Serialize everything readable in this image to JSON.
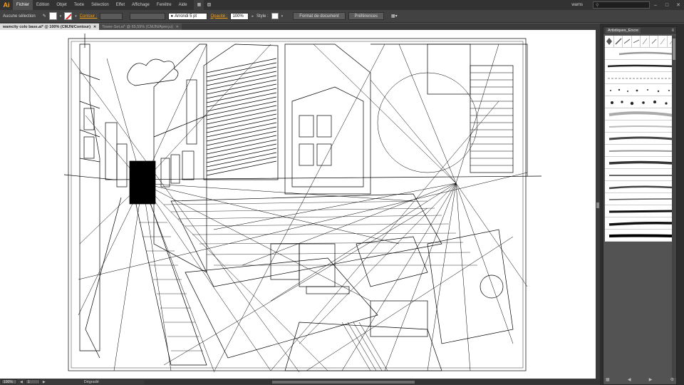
{
  "app": {
    "logo": "Ai",
    "workspace": "wams",
    "window_controls": [
      "–",
      "□",
      "✕"
    ]
  },
  "menu": {
    "items": [
      "Fichier",
      "Edition",
      "Objet",
      "Texte",
      "Sélection",
      "Effet",
      "Affichage",
      "Fenêtre",
      "Aide"
    ],
    "active": "Fichier"
  },
  "control_bar": {
    "selection": "Aucune sélection",
    "stroke_label": "Contour :",
    "brush_value": "Arrondi 5 pt",
    "opacity_label": "Opacité :",
    "opacity_value": "100%",
    "style_label": "Style :",
    "document_setup": "Format de document",
    "preferences": "Préférences"
  },
  "tabs": [
    {
      "label": "wamcity colo base.ai* @ 100% (CMJN/Contour)",
      "active": true
    },
    {
      "label": "Tower-Set.ai* @ 65,59% (CMJN/Aperçu)",
      "active": false
    }
  ],
  "status": {
    "zoom": "100%",
    "artboard": "1",
    "tool": "Dégradé"
  },
  "panel": {
    "title": "Artistiques_Encre",
    "menu_icon": "≡",
    "footer_icons": [
      "library-icon",
      "move-back-icon",
      "options-icon",
      "new-brush-icon",
      "delete-icon"
    ]
  },
  "colors": {
    "accent": "#f7a21b",
    "canvas": "#ffffff",
    "chrome": "#535353",
    "menubar": "#323232"
  }
}
